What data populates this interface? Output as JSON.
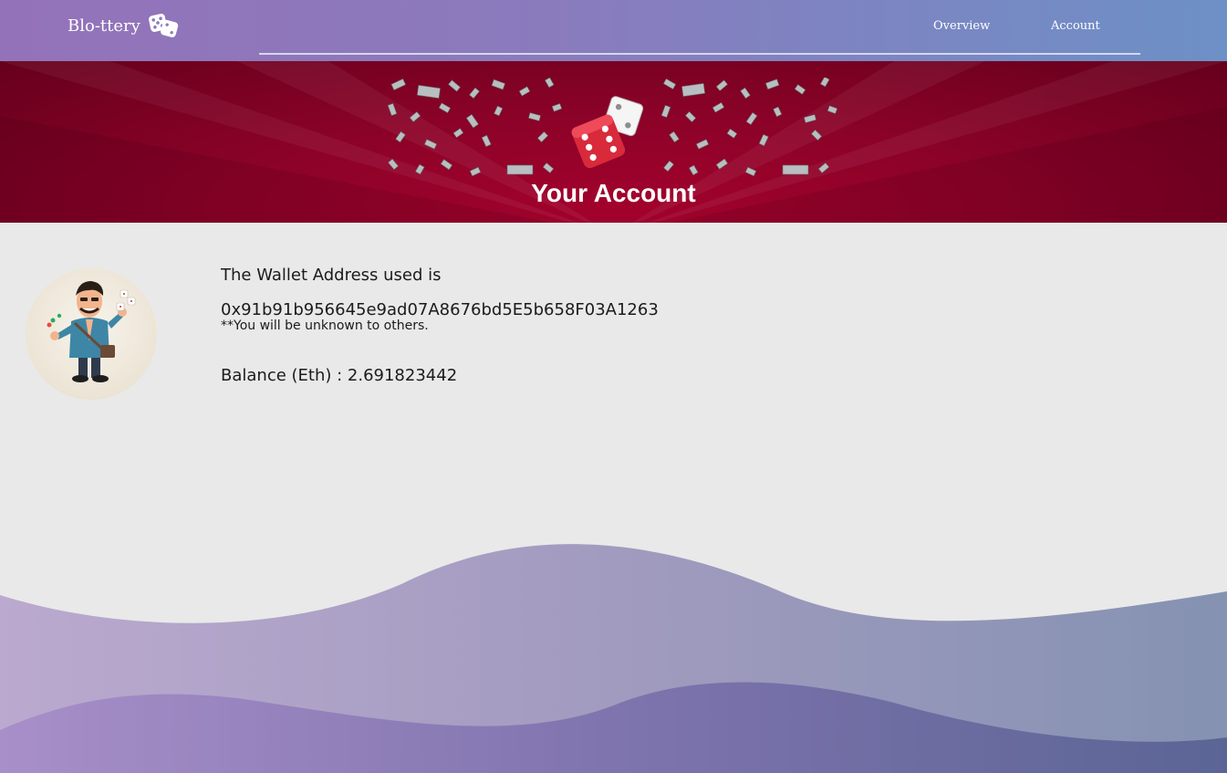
{
  "nav": {
    "brand": "Blo-ttery",
    "brand_icon": "dice-icon",
    "links": [
      {
        "label": "Overview"
      },
      {
        "label": "Account"
      }
    ]
  },
  "hero": {
    "title": "Your Account",
    "image": "dice-money-banner"
  },
  "account": {
    "avatar": "gambler-avatar",
    "wallet_label": "The Wallet Address used is",
    "wallet_address": "0x91b91b956645e9ad07A8676bd5E5b658F03A1263",
    "privacy_note": "**You will be unknown to others.",
    "balance_text": "Balance (Eth) : 2.691823442"
  },
  "colors": {
    "nav_gradient_start": "#9472b9",
    "nav_gradient_end": "#6d90c7",
    "hero_red": "#8b0228",
    "page_background": "#e9e9e9",
    "wave_light": "#b5a2cc",
    "wave_dark": "#6a6ea0"
  }
}
